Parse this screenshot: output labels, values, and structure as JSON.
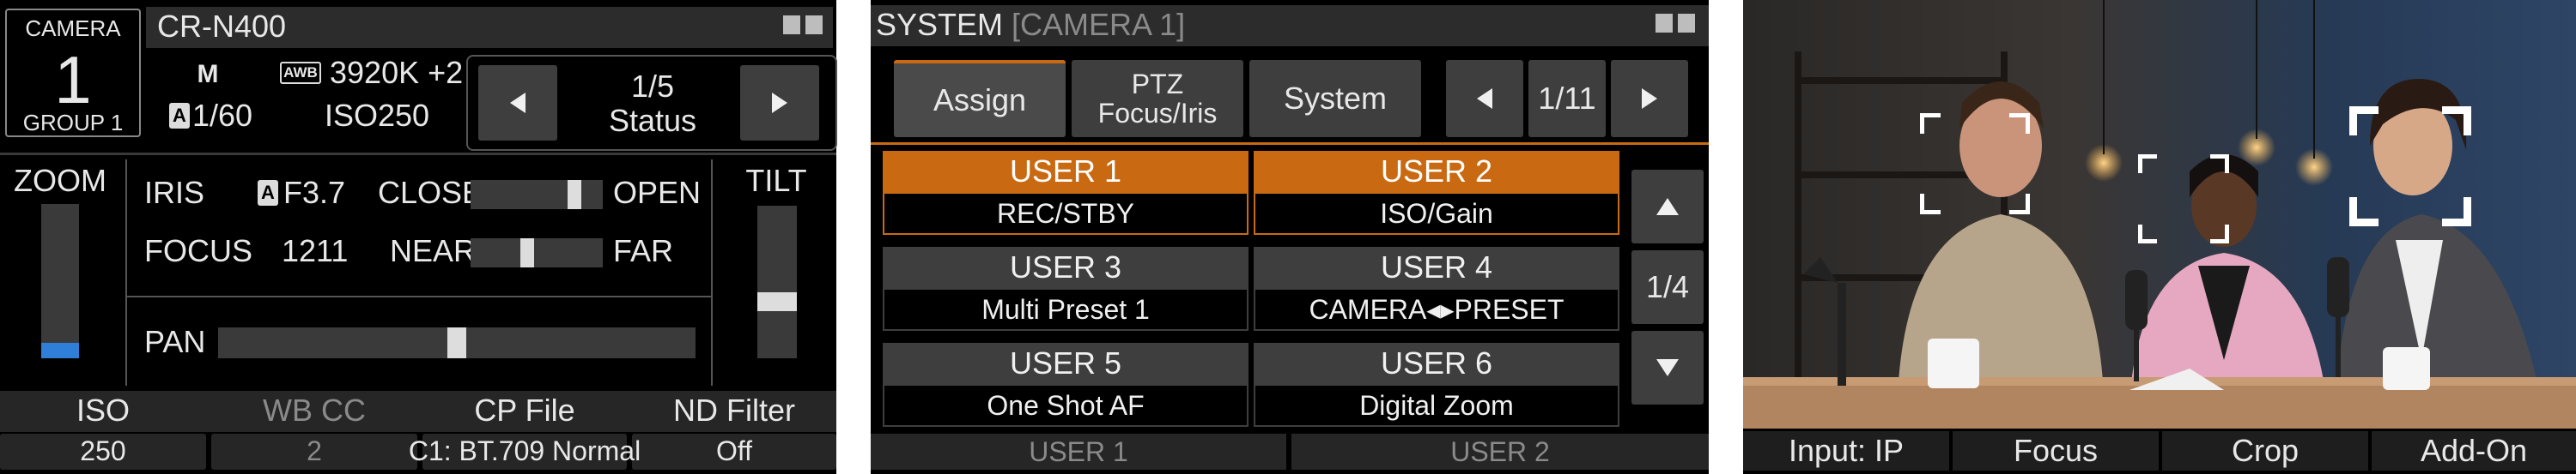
{
  "camera_panel": {
    "camera_badge": {
      "label": "CAMERA",
      "number": "1",
      "group": "GROUP 1"
    },
    "model": "CR-N400",
    "mode": "M",
    "awb_icon": "AWB",
    "white_balance": "3920K +2",
    "shutter_icon": "A",
    "shutter": "1/60",
    "iso_label": "ISO250",
    "page": {
      "indicator": "1/5",
      "name": "Status"
    },
    "zoom_label": "ZOOM",
    "zoom_level": 0.1,
    "iris": {
      "label": "IRIS",
      "auto_icon": "A",
      "value": "F3.7",
      "left": "CLOSE",
      "right": "OPEN",
      "level": 0.82
    },
    "focus": {
      "label": "FOCUS",
      "value": "1211",
      "left": "NEAR",
      "right": "FAR",
      "level": 0.42
    },
    "pan": {
      "label": "PAN",
      "level": 0.5
    },
    "tilt": {
      "label": "TILT",
      "level": 0.35
    },
    "footer_headers": [
      "ISO",
      "WB CC",
      "CP File",
      "ND Filter"
    ],
    "footer_values": [
      "250",
      "2",
      "C1: BT.709 Normal",
      "Off"
    ]
  },
  "system_panel": {
    "title": "SYSTEM",
    "subtitle": "[CAMERA 1]",
    "tabs": [
      "Assign",
      "PTZ\nFocus/Iris",
      "System"
    ],
    "page_indicator": "1/11",
    "users": [
      {
        "name": "USER 1",
        "value": "REC/STBY"
      },
      {
        "name": "USER 2",
        "value": "ISO/Gain"
      },
      {
        "name": "USER 3",
        "value": "Multi Preset 1"
      },
      {
        "name": "USER 4",
        "value": "CAMERA◂▸PRESET"
      },
      {
        "name": "USER 5",
        "value": "One Shot AF"
      },
      {
        "name": "USER 6",
        "value": "Digital Zoom"
      }
    ],
    "list_page": "1/4",
    "footer": [
      "USER 1",
      "USER 2"
    ]
  },
  "video_panel": {
    "footer": [
      "Input: IP",
      "Focus",
      "Crop",
      "Add-On"
    ]
  }
}
